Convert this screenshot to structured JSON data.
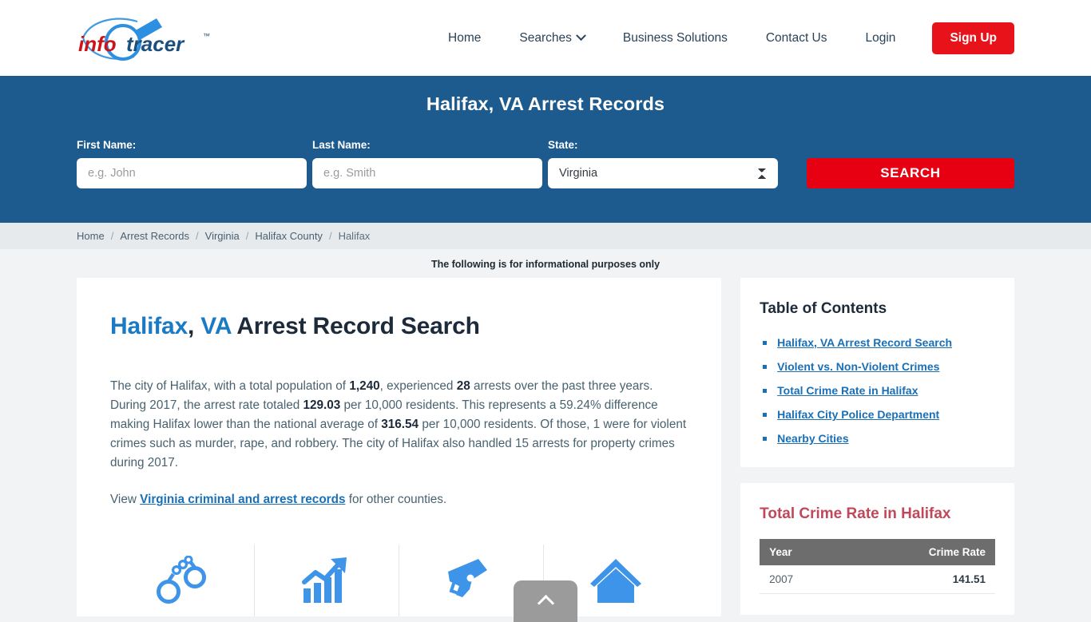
{
  "header": {
    "logo": {
      "part1": "info",
      "part2": "tracer",
      "tm": "™"
    },
    "nav": [
      {
        "label": "Home",
        "has_caret": false
      },
      {
        "label": "Searches",
        "has_caret": true
      },
      {
        "label": "Business Solutions",
        "has_caret": false
      },
      {
        "label": "Contact Us",
        "has_caret": false
      },
      {
        "label": "Login",
        "has_caret": false
      }
    ],
    "signup_label": "Sign Up"
  },
  "banner": {
    "title": "Halifax, VA Arrest Records",
    "first_name_label": "First Name:",
    "first_name_placeholder": "e.g. John",
    "first_name_value": "",
    "last_name_label": "Last Name:",
    "last_name_placeholder": "e.g. Smith",
    "last_name_value": "",
    "state_label": "State:",
    "state_value": "Virginia",
    "state_options": [
      "Virginia"
    ],
    "search_label": "SEARCH"
  },
  "breadcrumb": {
    "separator": "/",
    "items": [
      {
        "label": "Home",
        "current": false
      },
      {
        "label": "Arrest Records",
        "current": false
      },
      {
        "label": "Virginia",
        "current": false
      },
      {
        "label": "Halifax County",
        "current": false
      },
      {
        "label": "Halifax",
        "current": true
      }
    ]
  },
  "notice": "The following is for informational purposes only",
  "main": {
    "heading": {
      "city": "Halifax",
      "comma": ", ",
      "state": "VA",
      "rest": " Arrest Record Search"
    },
    "paragraph": {
      "s1": "The city of Halifax, with a total population of ",
      "b1": "1,240",
      "s2": ", experienced ",
      "b2": "28",
      "s3": " arrests over the past three years. During 2017, the arrest rate totaled ",
      "b3": "129.03",
      "s4": " per 10,000 residents. This represents a 59.24% difference making Halifax lower than the national average of ",
      "b4": "316.54",
      "s5": " per 10,000 residents. Of those, 1 were for violent crimes such as murder, rape, and robbery. The city of Halifax also handled 15 arrests for property crimes during 2017."
    },
    "view_line": {
      "prefix": "View ",
      "link": "Virginia criminal and arrest records",
      "suffix": " for other counties."
    },
    "icons": [
      {
        "name": "handcuffs-icon"
      },
      {
        "name": "growth-chart-icon"
      },
      {
        "name": "handgun-icon"
      },
      {
        "name": "house-icon"
      }
    ]
  },
  "sidebar": {
    "toc_title": "Table of Contents",
    "toc_items": [
      "Halifax, VA Arrest Record Search",
      "Violent vs. Non-Violent Crimes",
      "Total Crime Rate in Halifax",
      "Halifax City Police Department",
      "Nearby Cities"
    ],
    "crime_title": "Total Crime Rate in Halifax",
    "crime_table": {
      "columns": [
        "Year",
        "Crime Rate"
      ],
      "rows": [
        {
          "year": "2007",
          "rate": "141.51"
        }
      ]
    }
  },
  "scroll_top": {
    "name": "scroll-to-top"
  },
  "colors": {
    "banner_blue": "#1d5b8e",
    "brand_red": "#e8131a",
    "search_red": "#e60012",
    "link_blue": "#1a6fb5",
    "heading_blue": "#1a7bc4",
    "crime_red": "#c0485a",
    "table_header_gray": "#6d6d6d",
    "icon_blue": "#3d94e8",
    "page_bg": "#f2f3f5",
    "breadcrumb_bg": "#e7eaec"
  }
}
